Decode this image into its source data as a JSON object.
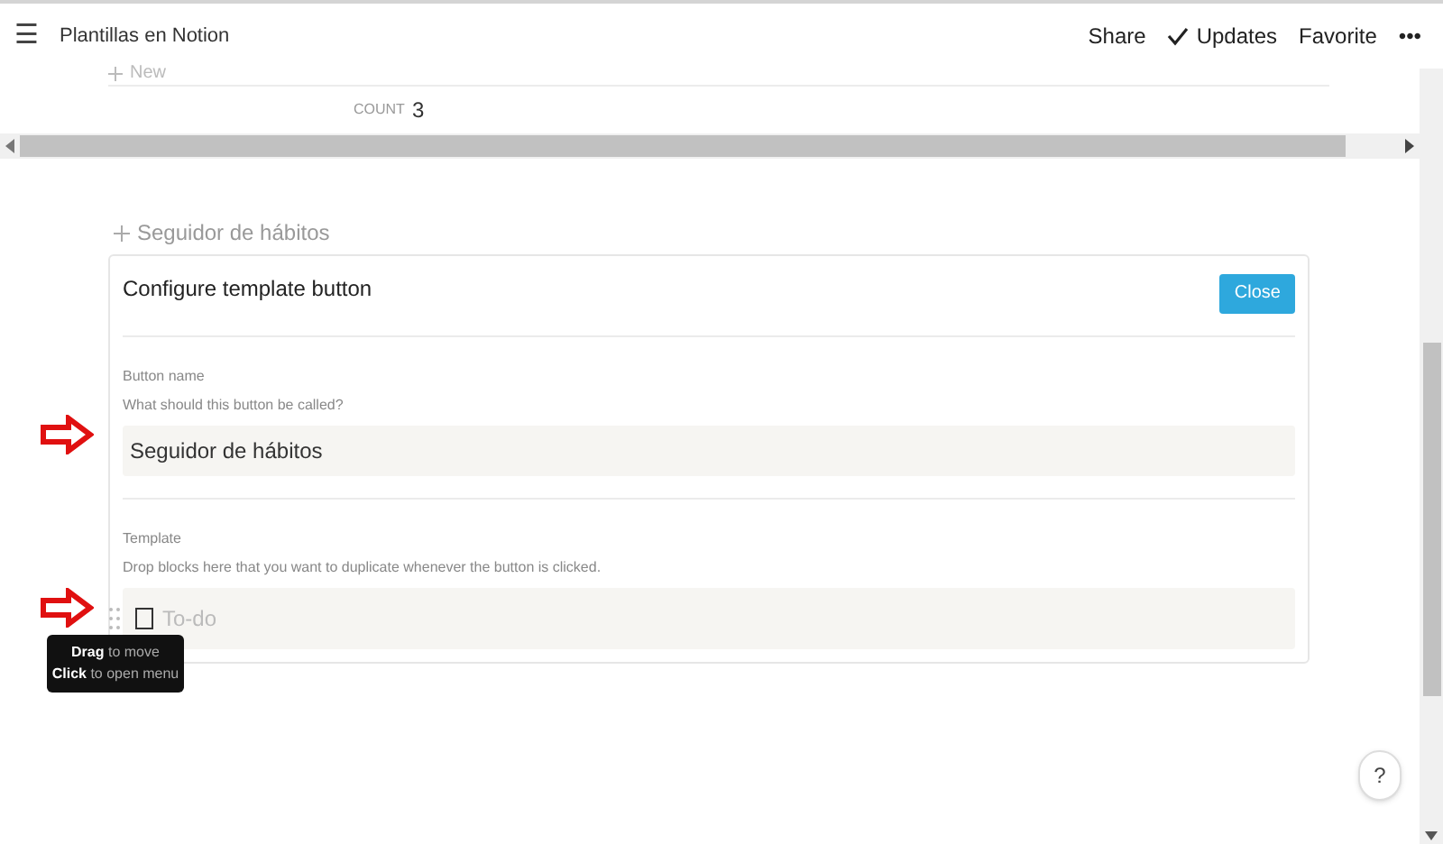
{
  "topbar": {
    "menu_icon": "☰",
    "title": "Plantillas en Notion",
    "actions": [
      {
        "label": "Share",
        "kind": "text"
      },
      {
        "label": "Updates",
        "kind": "check"
      },
      {
        "label": "Favorite",
        "kind": "text"
      },
      {
        "label": "•••",
        "kind": "text"
      }
    ]
  },
  "table": {
    "new_label": "New",
    "count_label": "COUNT",
    "count_value": "3"
  },
  "template_button": {
    "label": "Seguidor de hábitos"
  },
  "dialog": {
    "title": "Configure template button",
    "close": "Close",
    "name_section": {
      "label": "Button name",
      "hint": "What should this button be called?",
      "value": "Seguidor de hábitos"
    },
    "template_section": {
      "label": "Template",
      "hint": "Drop blocks here that you want to duplicate whenever the button is clicked.",
      "todo": {
        "placeholder": "To-do",
        "checked": false
      }
    }
  },
  "tooltip": {
    "lines": [
      "**Drag** to move",
      "**Click** to open menu"
    ]
  },
  "help": "?"
}
